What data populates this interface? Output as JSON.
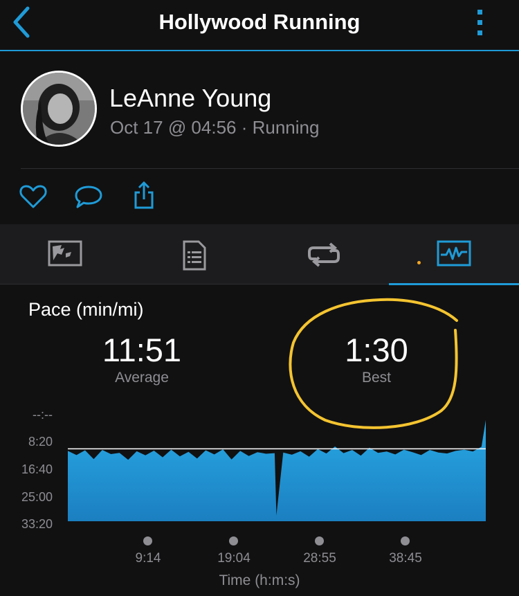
{
  "header": {
    "title": "Hollywood Running",
    "back_icon": "chevron-left-icon",
    "more_icon": "more-vertical-icon",
    "accent_color": "#1f9bd7"
  },
  "profile": {
    "name": "LeAnne Young",
    "meta": "Oct 17 @ 04:56 · Running"
  },
  "actions": [
    {
      "icon": "heart-icon"
    },
    {
      "icon": "comment-icon"
    },
    {
      "icon": "share-icon"
    }
  ],
  "tabs": [
    {
      "icon": "map-icon",
      "active": false
    },
    {
      "icon": "details-icon",
      "active": false
    },
    {
      "icon": "laps-icon",
      "active": false
    },
    {
      "icon": "chart-icon",
      "active": true
    }
  ],
  "metric": {
    "title": "Pace (min/mi)",
    "average": {
      "value": "11:51",
      "label": "Average"
    },
    "best": {
      "value": "1:30",
      "label": "Best"
    },
    "annotation_color": "#f4c430"
  },
  "chart_data": {
    "type": "area",
    "title": "Pace (min/mi)",
    "xlabel": "Time (h:m:s)",
    "ylabel": "",
    "y_tick_labels": [
      "--:--",
      "8:20",
      "16:40",
      "25:00",
      "33:20"
    ],
    "x_tick_labels": [
      "9:14",
      "19:04",
      "28:55",
      "38:45"
    ],
    "ylim_min_per_mi": [
      0,
      33.33
    ],
    "y_inverted": true,
    "x_minutes": [
      0,
      1,
      2,
      3,
      4,
      5,
      6,
      7,
      8,
      9,
      10,
      11,
      12,
      13,
      14,
      15,
      16,
      17,
      18,
      19,
      20,
      21,
      22,
      23,
      24,
      24.2,
      25,
      26,
      27,
      28,
      29,
      30,
      31,
      32,
      33,
      34,
      35,
      36,
      37,
      38,
      39,
      40,
      41,
      42,
      43,
      44,
      45,
      46,
      47,
      48,
      48.5
    ],
    "pace_min_per_mi": [
      11.2,
      12.5,
      11.0,
      13.8,
      10.9,
      12.2,
      11.8,
      14.0,
      11.3,
      12.6,
      11.1,
      13.2,
      10.8,
      12.9,
      11.5,
      13.6,
      11.0,
      12.3,
      10.7,
      13.9,
      11.2,
      12.8,
      11.6,
      12.1,
      11.9,
      31.5,
      11.7,
      12.4,
      11.3,
      13.0,
      10.6,
      12.0,
      9.8,
      11.9,
      10.9,
      12.7,
      10.2,
      11.8,
      11.4,
      12.3,
      10.8,
      11.6,
      12.5,
      10.9,
      11.7,
      12.0,
      11.2,
      10.8,
      11.4,
      9.9,
      1.5
    ],
    "average_pace_line": "11:51",
    "series_color": "#1f9bd7"
  }
}
